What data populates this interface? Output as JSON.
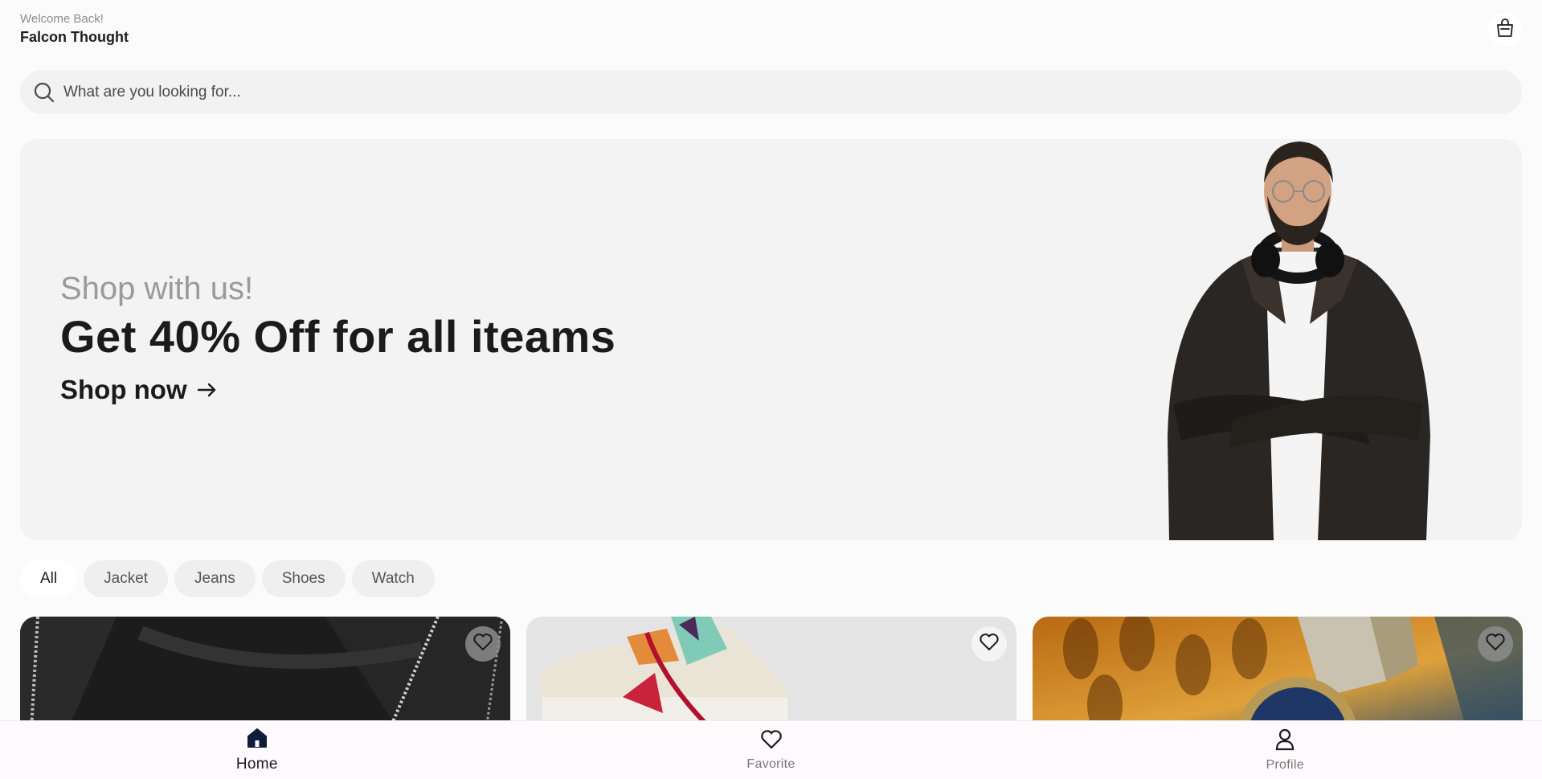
{
  "header": {
    "welcome": "Welcome Back!",
    "username": "Falcon Thought",
    "bag_icon": "shopping-bag-icon"
  },
  "search": {
    "placeholder": "What are you looking for...",
    "value": "",
    "icon": "search-icon"
  },
  "banner": {
    "subtitle": "Shop with us!",
    "title": "Get 40% Off for all iteams",
    "cta": "Shop now",
    "cta_icon": "arrow-right-icon"
  },
  "categories": [
    {
      "label": "All",
      "active": true
    },
    {
      "label": "Jacket",
      "active": false
    },
    {
      "label": "Jeans",
      "active": false
    },
    {
      "label": "Shoes",
      "active": false
    },
    {
      "label": "Watch",
      "active": false
    }
  ],
  "products": [
    {
      "name": "leather-jacket",
      "favorited": false
    },
    {
      "name": "sneakers",
      "favorited": false
    },
    {
      "name": "wristwatch",
      "favorited": false
    }
  ],
  "bottom_nav": [
    {
      "label": "Home",
      "icon": "home-icon",
      "active": true
    },
    {
      "label": "Favorite",
      "icon": "heart-icon",
      "active": false
    },
    {
      "label": "Profile",
      "icon": "user-icon",
      "active": false
    }
  ],
  "colors": {
    "background": "#fbfbfb",
    "surface": "#f3f3f3",
    "text_dark": "#1b1b1b",
    "text_muted": "#9a9a9a",
    "nav_bg": "#fefafd"
  }
}
